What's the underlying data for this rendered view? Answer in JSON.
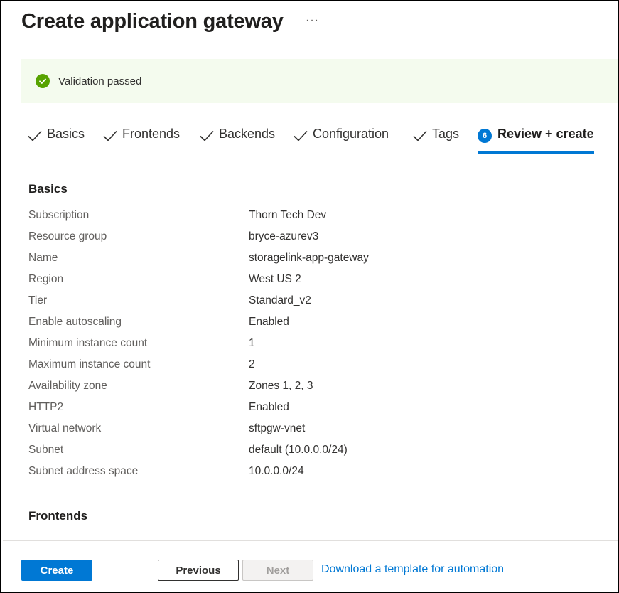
{
  "header": {
    "title": "Create application gateway",
    "more_label": "···"
  },
  "banner": {
    "status": "success",
    "text": "Validation passed",
    "color": "#57a300"
  },
  "tabs": [
    {
      "label": "Basics",
      "state": "completed"
    },
    {
      "label": "Frontends",
      "state": "completed"
    },
    {
      "label": "Backends",
      "state": "completed"
    },
    {
      "label": "Configuration",
      "state": "completed"
    },
    {
      "label": "Tags",
      "state": "completed"
    },
    {
      "label": "Review + create",
      "state": "active",
      "step": "6"
    }
  ],
  "basics": {
    "title": "Basics",
    "rows": [
      {
        "key": "Subscription",
        "value": "Thorn Tech Dev"
      },
      {
        "key": "Resource group",
        "value": "bryce-azurev3"
      },
      {
        "key": "Name",
        "value": "storagelink-app-gateway"
      },
      {
        "key": "Region",
        "value": "West US 2"
      },
      {
        "key": "Tier",
        "value": "Standard_v2"
      },
      {
        "key": "Enable autoscaling",
        "value": "Enabled"
      },
      {
        "key": "Minimum instance count",
        "value": "1"
      },
      {
        "key": "Maximum instance count",
        "value": "2"
      },
      {
        "key": "Availability zone",
        "value": "Zones 1, 2, 3"
      },
      {
        "key": "HTTP2",
        "value": "Enabled"
      },
      {
        "key": "Virtual network",
        "value": "sftpgw-vnet"
      },
      {
        "key": "Subnet",
        "value": "default (10.0.0.0/24)"
      },
      {
        "key": "Subnet address space",
        "value": "10.0.0.0/24"
      }
    ]
  },
  "frontends": {
    "title": "Frontends"
  },
  "footer": {
    "create_label": "Create",
    "previous_label": "Previous",
    "next_label": "Next",
    "download_link": "Download a template for automation"
  },
  "colors": {
    "accent": "#0078d4",
    "success": "#57a300"
  }
}
